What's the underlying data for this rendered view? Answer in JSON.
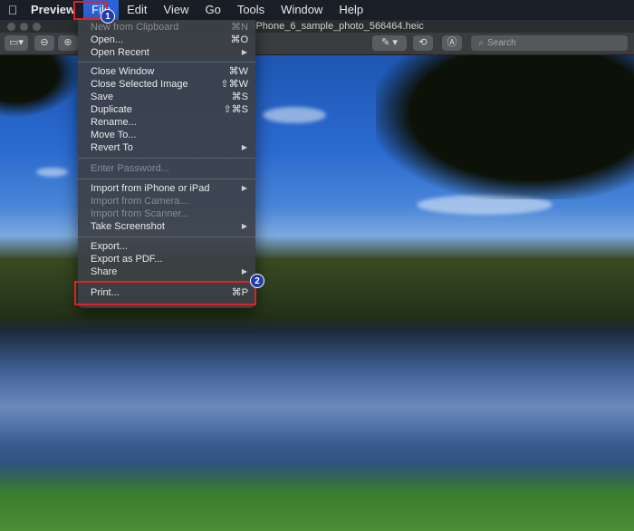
{
  "menubar": {
    "app_name": "Preview",
    "items": [
      "File",
      "Edit",
      "View",
      "Go",
      "Tools",
      "Window",
      "Help"
    ]
  },
  "window": {
    "title": "iPhone_6_sample_photo_566464.heic",
    "search_placeholder": "Search"
  },
  "file_menu": {
    "new_from_clipboard": {
      "label": "New from Clipboard",
      "shortcut": "⌘N"
    },
    "open": {
      "label": "Open...",
      "shortcut": "⌘O"
    },
    "open_recent": {
      "label": "Open Recent"
    },
    "close_window": {
      "label": "Close Window",
      "shortcut": "⌘W"
    },
    "close_selected_image": {
      "label": "Close Selected Image",
      "shortcut": "⇧⌘W"
    },
    "save": {
      "label": "Save",
      "shortcut": "⌘S"
    },
    "duplicate": {
      "label": "Duplicate",
      "shortcut": "⇧⌘S"
    },
    "rename": {
      "label": "Rename..."
    },
    "move_to": {
      "label": "Move To..."
    },
    "revert_to": {
      "label": "Revert To"
    },
    "enter_password": {
      "label": "Enter Password..."
    },
    "import_iphone": {
      "label": "Import from iPhone or iPad"
    },
    "import_camera": {
      "label": "Import from Camera..."
    },
    "import_scanner": {
      "label": "Import from Scanner..."
    },
    "take_screenshot": {
      "label": "Take Screenshot"
    },
    "export": {
      "label": "Export..."
    },
    "export_pdf": {
      "label": "Export as PDF..."
    },
    "share": {
      "label": "Share"
    },
    "print": {
      "label": "Print...",
      "shortcut": "⌘P"
    }
  },
  "annotations": {
    "step1": "1",
    "step2": "2"
  },
  "colors": {
    "highlight": "#e32025",
    "badge": "#1f3ea8",
    "menu_active": "#2a64d8"
  },
  "icons": {
    "apple": "apple-logo-icon",
    "submenu": "chevron-right-icon",
    "search": "search-icon"
  }
}
